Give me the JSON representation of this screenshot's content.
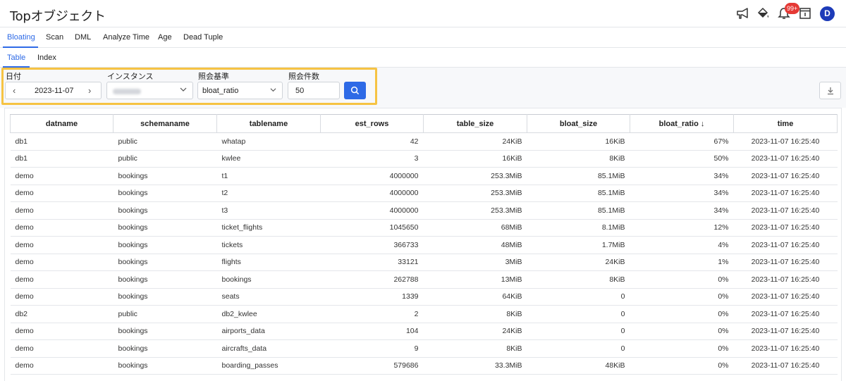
{
  "header": {
    "title": "Topオブジェクト",
    "notification_count": "99+",
    "avatar_initial": "D",
    "icons": [
      "megaphone-icon",
      "paint-bucket-icon",
      "bell-icon",
      "info-panel-icon"
    ]
  },
  "tabs_primary": [
    {
      "label": "Bloating",
      "active": true
    },
    {
      "label": "Scan"
    },
    {
      "label": "DML"
    },
    {
      "label": "Analyze Time"
    },
    {
      "label": "Age"
    },
    {
      "label": "Dead Tuple"
    }
  ],
  "tabs_secondary": [
    {
      "label": "Table",
      "active": true
    },
    {
      "label": "Index"
    }
  ],
  "filters": {
    "date_label": "日付",
    "date_value": "2023-11-07",
    "instance_label": "インスタンス",
    "criteria_label": "照会基準",
    "criteria_value": "bloat_ratio",
    "count_label": "照会件数",
    "count_value": "50"
  },
  "table": {
    "columns": [
      "datname",
      "schemaname",
      "tablename",
      "est_rows",
      "table_size",
      "bloat_size",
      "bloat_ratio ↓",
      "time"
    ],
    "rows": [
      [
        "db1",
        "public",
        "whatap",
        "42",
        "24KiB",
        "16KiB",
        "67%",
        "2023-11-07 16:25:40"
      ],
      [
        "db1",
        "public",
        "kwlee",
        "3",
        "16KiB",
        "8KiB",
        "50%",
        "2023-11-07 16:25:40"
      ],
      [
        "demo",
        "bookings",
        "t1",
        "4000000",
        "253.3MiB",
        "85.1MiB",
        "34%",
        "2023-11-07 16:25:40"
      ],
      [
        "demo",
        "bookings",
        "t2",
        "4000000",
        "253.3MiB",
        "85.1MiB",
        "34%",
        "2023-11-07 16:25:40"
      ],
      [
        "demo",
        "bookings",
        "t3",
        "4000000",
        "253.3MiB",
        "85.1MiB",
        "34%",
        "2023-11-07 16:25:40"
      ],
      [
        "demo",
        "bookings",
        "ticket_flights",
        "1045650",
        "68MiB",
        "8.1MiB",
        "12%",
        "2023-11-07 16:25:40"
      ],
      [
        "demo",
        "bookings",
        "tickets",
        "366733",
        "48MiB",
        "1.7MiB",
        "4%",
        "2023-11-07 16:25:40"
      ],
      [
        "demo",
        "bookings",
        "flights",
        "33121",
        "3MiB",
        "24KiB",
        "1%",
        "2023-11-07 16:25:40"
      ],
      [
        "demo",
        "bookings",
        "bookings",
        "262788",
        "13MiB",
        "8KiB",
        "0%",
        "2023-11-07 16:25:40"
      ],
      [
        "demo",
        "bookings",
        "seats",
        "1339",
        "64KiB",
        "0",
        "0%",
        "2023-11-07 16:25:40"
      ],
      [
        "db2",
        "public",
        "db2_kwlee",
        "2",
        "8KiB",
        "0",
        "0%",
        "2023-11-07 16:25:40"
      ],
      [
        "demo",
        "bookings",
        "airports_data",
        "104",
        "24KiB",
        "0",
        "0%",
        "2023-11-07 16:25:40"
      ],
      [
        "demo",
        "bookings",
        "aircrafts_data",
        "9",
        "8KiB",
        "0",
        "0%",
        "2023-11-07 16:25:40"
      ],
      [
        "demo",
        "bookings",
        "boarding_passes",
        "579686",
        "33.3MiB",
        "48KiB",
        "0%",
        "2023-11-07 16:25:40"
      ]
    ]
  },
  "colors": {
    "accent": "#2e6ae6",
    "highlight": "#f6c343",
    "badge": "#e53935",
    "avatar": "#1d3bb8"
  }
}
